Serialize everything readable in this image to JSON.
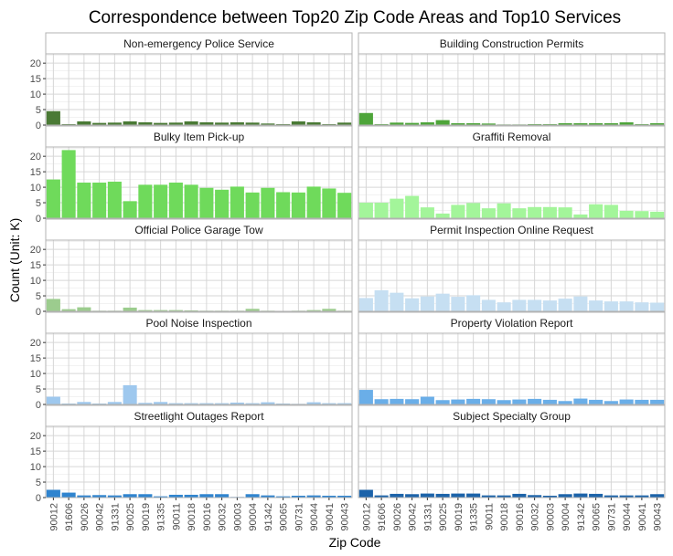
{
  "chart_data": {
    "type": "bar",
    "title": "Correspondence between Top20 Zip Code Areas and Top10 Services",
    "xlabel": "Zip Code",
    "ylabel": "Count (Unit: K)",
    "categories": [
      "90012",
      "91606",
      "90026",
      "90042",
      "91331",
      "90025",
      "90019",
      "91335",
      "90011",
      "90018",
      "90016",
      "90032",
      "90003",
      "90004",
      "91342",
      "90065",
      "90731",
      "90044",
      "90041",
      "90043"
    ],
    "ylim": [
      0,
      23
    ],
    "yticks": [
      0,
      5,
      10,
      15,
      20
    ],
    "grid": true,
    "legend": "none",
    "panels": [
      {
        "name": "Non-emergency Police Service",
        "color": "#4a7a35",
        "values": [
          4.5,
          0.3,
          1.2,
          0.7,
          0.8,
          1.2,
          0.9,
          0.7,
          0.8,
          1.2,
          0.9,
          0.8,
          0.9,
          0.8,
          0.5,
          0.3,
          1.2,
          0.9,
          0.3,
          0.8
        ]
      },
      {
        "name": "Building Construction Permits",
        "color": "#4ea53a",
        "values": [
          3.9,
          0.3,
          0.8,
          0.7,
          0.9,
          1.6,
          0.6,
          0.6,
          0.5,
          0.2,
          0.2,
          0.3,
          0.3,
          0.6,
          0.6,
          0.6,
          0.6,
          0.9,
          0.3,
          0.6
        ]
      },
      {
        "name": "Bulky Item Pick-up",
        "color": "#6fda5b",
        "values": [
          12.5,
          22,
          11.5,
          11.5,
          11.8,
          5.5,
          10.8,
          10.8,
          11.5,
          10.8,
          9.8,
          9.2,
          10.2,
          8.3,
          9.8,
          8.4,
          8.3,
          10.2,
          9.6,
          8.2
        ]
      },
      {
        "name": "Graffiti Removal",
        "color": "#a3f59a",
        "values": [
          5,
          5,
          6.3,
          7.2,
          3.5,
          1.5,
          4.3,
          4.9,
          3.2,
          4.8,
          3.2,
          3.6,
          3.6,
          3.5,
          1.2,
          4.5,
          4.3,
          2.4,
          2.3,
          2.1
        ]
      },
      {
        "name": "Official Police Garage Tow",
        "color": "#9ccc8e",
        "values": [
          4,
          0.7,
          1.3,
          0.2,
          0.2,
          1.2,
          0.4,
          0.4,
          0.4,
          0.3,
          0.2,
          0.2,
          0.2,
          0.8,
          0.2,
          0.1,
          0.2,
          0.4,
          0.8,
          0.2
        ]
      },
      {
        "name": "Permit Inspection Online Request",
        "color": "#c6dff2",
        "values": [
          4.3,
          6.8,
          6,
          4.2,
          4.8,
          5.7,
          4.7,
          5.2,
          3.7,
          2.9,
          3.7,
          3.7,
          3.5,
          4.1,
          4.8,
          3.5,
          3.2,
          3.2,
          2.9,
          2.8
        ]
      },
      {
        "name": "Pool Noise Inspection",
        "color": "#9ec8ee",
        "values": [
          2.5,
          0.3,
          0.8,
          0.3,
          0.8,
          6.2,
          0.5,
          0.8,
          0.4,
          0.4,
          0.4,
          0.4,
          0.6,
          0.4,
          0.7,
          0.3,
          0.2,
          0.7,
          0.4,
          0.4
        ]
      },
      {
        "name": "Property Violation Report",
        "color": "#6aaee8",
        "values": [
          4.7,
          1.7,
          1.8,
          1.7,
          2.5,
          1.4,
          1.6,
          1.8,
          1.7,
          1.4,
          1.6,
          1.8,
          1.5,
          1.1,
          1.9,
          1.5,
          1.1,
          1.6,
          1.5,
          1.5
        ]
      },
      {
        "name": "Streetlight Outages Report",
        "color": "#2f84cf",
        "values": [
          2.5,
          1.6,
          0.7,
          0.8,
          0.7,
          1.1,
          1.1,
          0.4,
          0.9,
          0.9,
          1.1,
          1.1,
          0.2,
          1.1,
          0.7,
          0.4,
          0.6,
          0.7,
          0.6,
          0.6
        ]
      },
      {
        "name": "Subject Specialty Group",
        "color": "#1c63a9",
        "values": [
          2.5,
          0.7,
          1.2,
          1.1,
          1.3,
          1.2,
          1.3,
          1.3,
          0.7,
          0.7,
          1.2,
          0.8,
          0.6,
          1.1,
          1.3,
          1.2,
          0.7,
          0.7,
          0.7,
          1.1
        ]
      }
    ]
  }
}
